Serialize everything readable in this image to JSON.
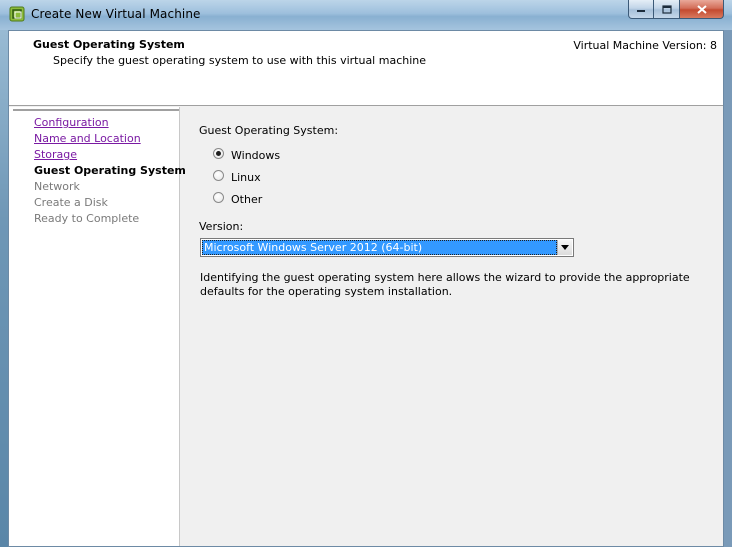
{
  "window": {
    "title": "Create New Virtual Machine",
    "icon": "vm-wizard-icon"
  },
  "header": {
    "title": "Guest Operating System",
    "subtitle": "Specify the guest operating system to use with this virtual machine",
    "version_text": "Virtual Machine Version: 8"
  },
  "nav": {
    "steps": [
      {
        "label": "Configuration",
        "state": "completed"
      },
      {
        "label": "Name and Location",
        "state": "completed"
      },
      {
        "label": "Storage",
        "state": "completed"
      },
      {
        "label": "Guest Operating System",
        "state": "current"
      },
      {
        "label": "Network",
        "state": "future"
      },
      {
        "label": "Create a Disk",
        "state": "future"
      },
      {
        "label": "Ready to Complete",
        "state": "future"
      }
    ]
  },
  "main": {
    "os_label": "Guest Operating System:",
    "os_options": [
      {
        "label": "Windows",
        "checked": true
      },
      {
        "label": "Linux",
        "checked": false
      },
      {
        "label": "Other",
        "checked": false
      }
    ],
    "version_label": "Version:",
    "version_selected": "Microsoft Windows Server 2012 (64-bit)",
    "description": "Identifying the guest operating system here allows the wizard to provide the appropriate defaults for the operating system installation."
  },
  "colors": {
    "link": "#7a1aa3",
    "selection": "#3399ff"
  }
}
